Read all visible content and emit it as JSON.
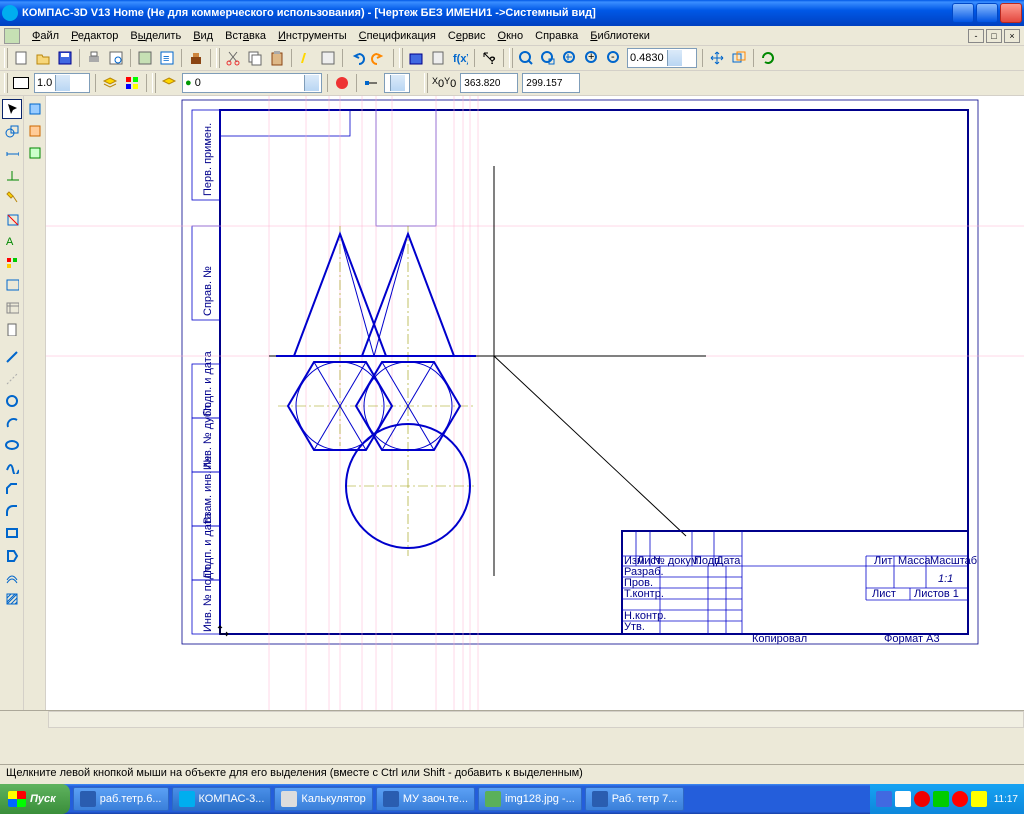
{
  "title": "КОМПАС-3D V13 Home (Не для коммерческого использования) - [Чертеж БЕЗ ИМЕНИ1 ->Системный вид]",
  "menu": {
    "file": "Файл",
    "edit": "Редактор",
    "select": "Выделить",
    "view": "Вид",
    "insert": "Вставка",
    "tools": "Инструменты",
    "spec": "Спецификация",
    "service": "Сервис",
    "window": "Окно",
    "help": "Справка",
    "libs": "Библиотеки"
  },
  "toolbar": {
    "zoom": "0.4830",
    "coord_x": "363.820",
    "coord_y": "299.157",
    "scale": "1.0",
    "layer": "0"
  },
  "titleblock": {
    "cols": [
      "Изм",
      "Лист",
      "№ докум.",
      "Подп.",
      "Дата"
    ],
    "rows": [
      "Разраб.",
      "Пров.",
      "Т.контр.",
      "Н.контр.",
      "Утв."
    ],
    "lit": "Лит",
    "massa": "Масса",
    "masshtab": "Масштаб",
    "mscale": "1:1",
    "list": "Лист",
    "listov": "Листов 1",
    "kop": "Копировал",
    "format": "Формат   A3"
  },
  "sideblock": [
    "Перв. примен.",
    "Справ. №",
    "Подп. и дата",
    "Инв. № дубл.",
    "Взам. инв. №",
    "Подп. и дата",
    "Инв. № подл."
  ],
  "status": "Щелкните левой кнопкой мыши на объекте для его выделения (вместе с Ctrl или Shift - добавить к выделенным)",
  "taskbar": {
    "start": "Пуск",
    "items": [
      "раб.тетр.6...",
      "КОМПАС-3...",
      "Калькулятор",
      "МУ заоч.те...",
      "img128.jpg -...",
      "Раб. тетр 7..."
    ],
    "clock": "11:17"
  }
}
